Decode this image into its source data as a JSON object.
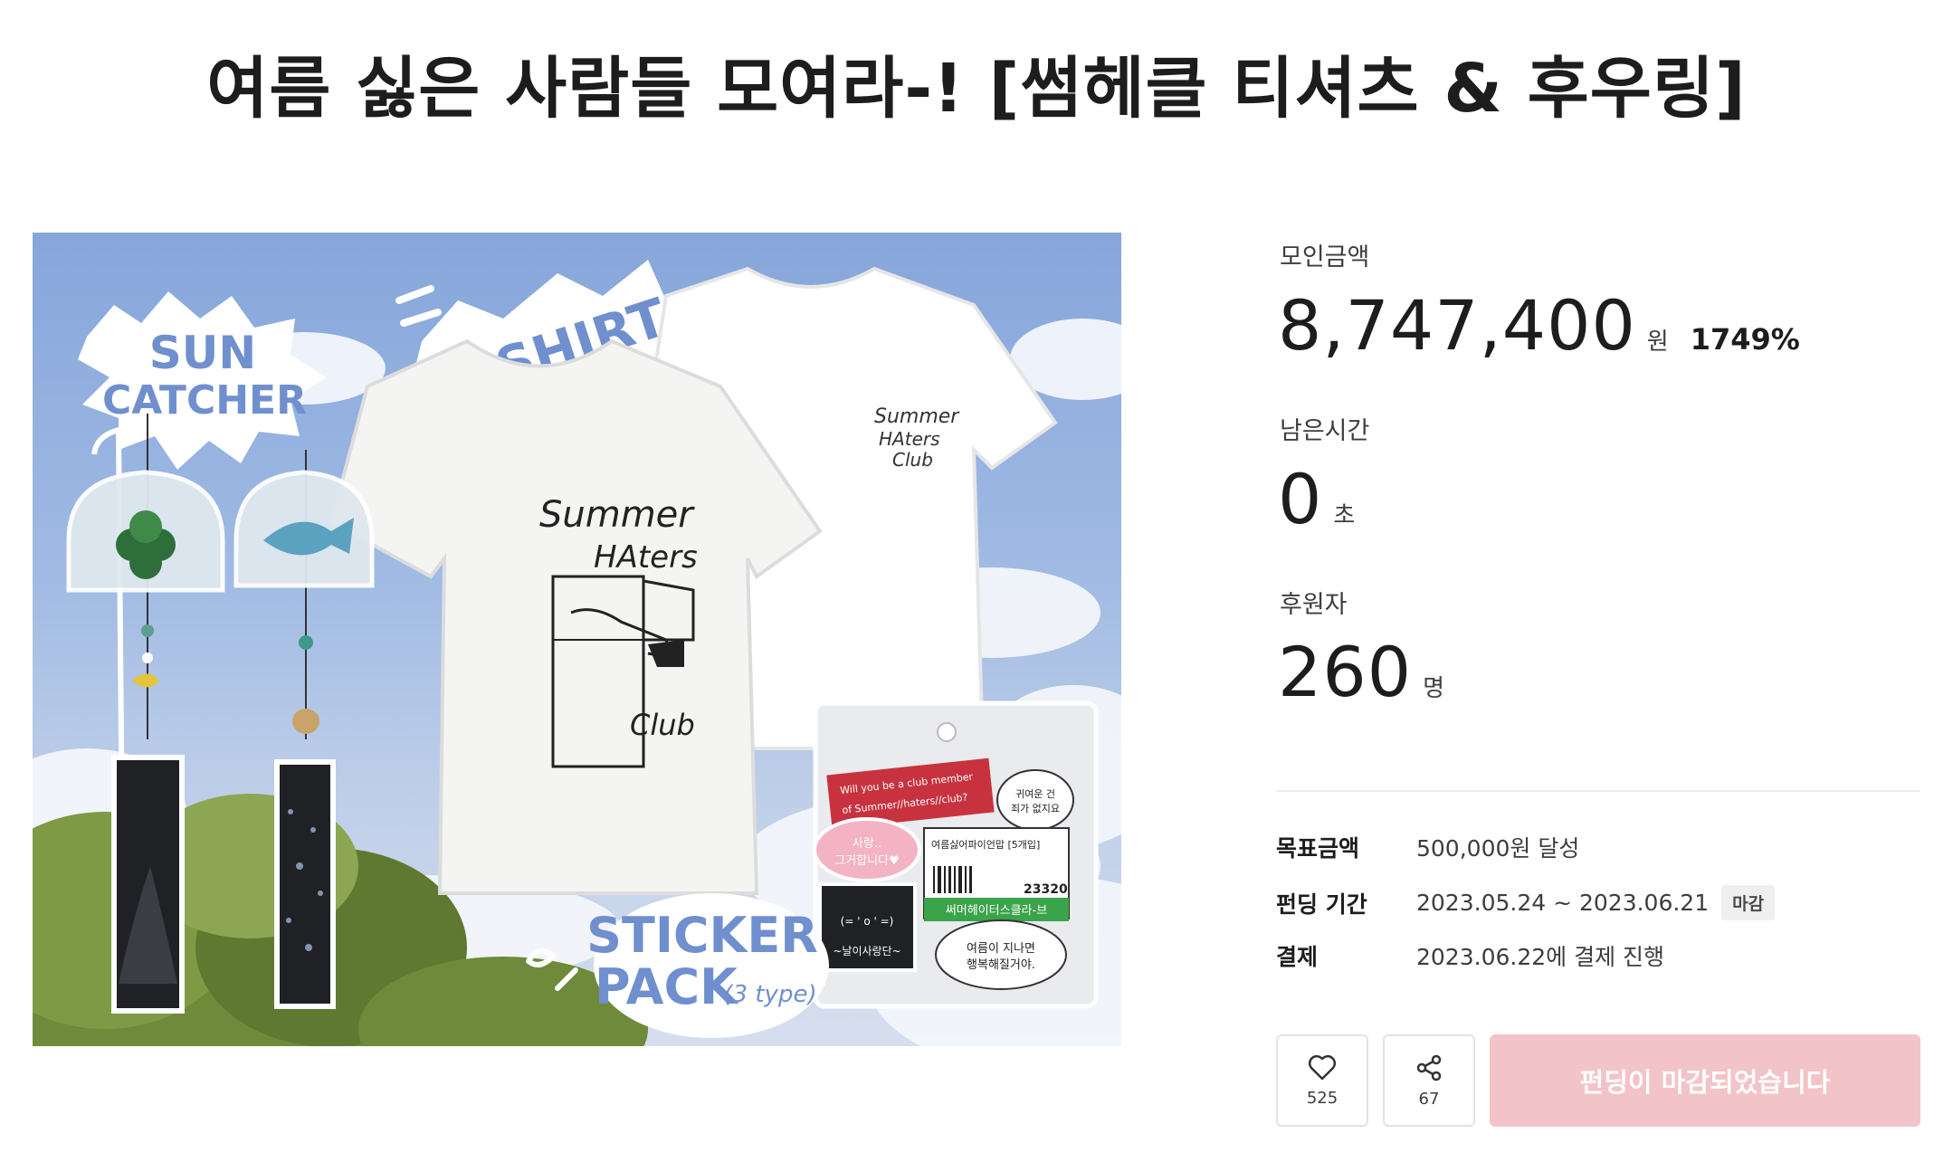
{
  "page": {
    "title": "여름 싫은 사람들 모여라-! [썸헤클 티셔츠 & 후우링]"
  },
  "hero": {
    "labels": {
      "sun_catcher_1": "SUN",
      "sun_catcher_2": "CATCHER",
      "tshirt": "T-SHIRT",
      "sticker_1": "STICKER",
      "sticker_2": "PACK",
      "sticker_3": "(3 type)"
    },
    "shirt_print": {
      "line1": "Summer",
      "line2": "HAters",
      "line3": "Club"
    },
    "sticker_pack": {
      "banner_1": "Will you be a club member",
      "banner_2": "of Summer//haters//club?",
      "bubble_1": "귀여운 건",
      "bubble_2": "죄가 없지요",
      "pink_1": "사랑..",
      "pink_2": "그거합니다♥",
      "ticket_title": "여름싫어파이언맙 [5개입]",
      "ticket_number": "23320",
      "green_label": "써머헤이터스클라-브",
      "dark_1": "(= ' o ' =)",
      "dark_2": "~날이사랑단~",
      "round_1": "여름이 지나면",
      "round_2": "행복해질거야."
    },
    "colors": {
      "sky_top": "#86a6da",
      "tree_green": "#6e8a3a",
      "shirt": "#f4f4f2",
      "tag_dark": "#1f2124",
      "sticker_red": "#c8323f",
      "sticker_green": "#3aa44a",
      "label_blue": "#6f8fcf"
    }
  },
  "stats": {
    "amount_label": "모인금액",
    "amount_value": "8,747,400",
    "amount_unit": "원",
    "amount_percent": "1749%",
    "time_label": "남은시간",
    "time_value": "0",
    "time_unit": "초",
    "backers_label": "후원자",
    "backers_value": "260",
    "backers_unit": "명"
  },
  "details": {
    "goal_key": "목표금액",
    "goal_value": "500,000원 달성",
    "period_key": "펀딩 기간",
    "period_value": "2023.05.24 ~ 2023.06.21",
    "period_badge": "마감",
    "payment_key": "결제",
    "payment_value": "2023.06.22에 결제 진행"
  },
  "actions": {
    "like_icon": "heart-icon",
    "like_count": "525",
    "share_icon": "share-icon",
    "share_count": "67",
    "closed_label": "펀딩이 마감되었습니다",
    "closed_color": "#f3c4c7"
  }
}
